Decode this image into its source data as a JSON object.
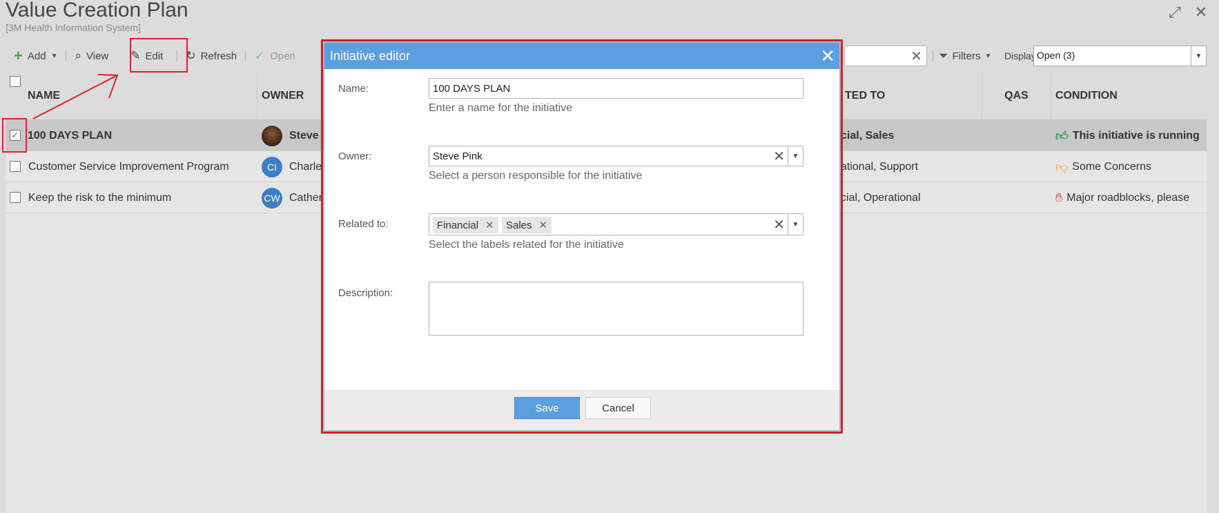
{
  "window": {
    "title": "Value Creation Plan",
    "subtitle": "[3M Health Information System]"
  },
  "toolbar": {
    "add_label": "Add",
    "view_label": "View",
    "edit_label": "Edit",
    "refresh_label": "Refresh",
    "open_label": "Open",
    "filters_label": "Filters",
    "display_label": "Display",
    "display_value": "Open (3)"
  },
  "grid": {
    "columns": {
      "name": "NAME",
      "owner": "OWNER",
      "related_to": "TED TO",
      "qas": "QAS",
      "condition": "CONDITION"
    },
    "rows": [
      {
        "name": "100 DAYS PLAN",
        "owner_initials": "",
        "owner": "Steve",
        "related": "cial, Sales",
        "condition": "This initiative is running",
        "condition_icon": "thumbs-up-icon",
        "condition_color": "#3aa655"
      },
      {
        "name": "Customer Service Improvement Program",
        "owner_initials": "CI",
        "owner": "Charle",
        "related": "ational, Support",
        "condition": "Some Concerns",
        "condition_icon": "thumbs-down-icon",
        "condition_color": "#f0a030"
      },
      {
        "name": "Keep the risk to the minimum",
        "owner_initials": "CW",
        "owner": "Cather",
        "related": "cial, Operational",
        "condition": "Major roadblocks, please",
        "condition_icon": "stop-hand-icon",
        "condition_color": "#d43a3a"
      }
    ]
  },
  "dialog": {
    "title": "Initiative editor",
    "name_label": "Name:",
    "name_value": "100 DAYS PLAN",
    "name_hint": "Enter a name for the initiative",
    "owner_label": "Owner:",
    "owner_value": "Steve Pink",
    "owner_hint": "Select a person responsible for the initiative",
    "related_label": "Related to:",
    "related_tags": [
      "Financial",
      "Sales"
    ],
    "related_hint": "Select the labels related for the initiative",
    "description_label": "Description:",
    "description_value": "",
    "save_label": "Save",
    "cancel_label": "Cancel"
  },
  "colors": {
    "accent": "#5c9fe0",
    "annotation": "#e0202c"
  }
}
